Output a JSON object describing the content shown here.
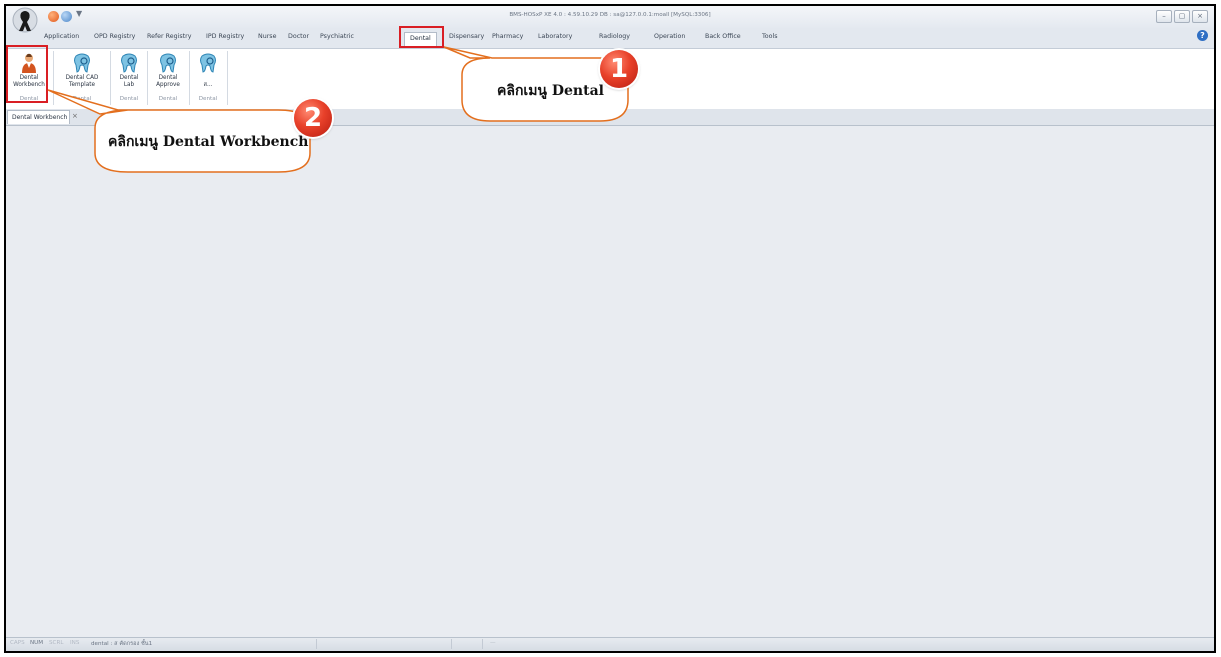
{
  "window": {
    "title": "BMS-HOSxP XE 4.0 : 4.59.10.29 DB : sa@127.0.0.1:moall [MySQL:3306]",
    "controls": [
      "–",
      "▢",
      "×"
    ]
  },
  "menu": {
    "tabs": [
      "Application",
      "OPD Registry",
      "Refer Registry",
      "IPD Registry",
      "Nurse",
      "Doctor",
      "Psychiatric",
      "Dental",
      "Dispensary",
      "Pharmacy",
      "Laboratory",
      "Radiology",
      "Operation",
      "Back Office",
      "Tools"
    ],
    "active_tab": "Dental",
    "help_icon": "?"
  },
  "ribbon": {
    "items": [
      {
        "label_line1": "Dental",
        "label_line2": "Workbench",
        "group": "Dental",
        "icon": "dentist-person-icon"
      },
      {
        "label_line1": "Dental CAD",
        "label_line2": "Template",
        "group": "Dental",
        "icon": "tooth-icon"
      },
      {
        "label_line1": "Dental",
        "label_line2": "Lab",
        "group": "Dental",
        "icon": "tooth-icon"
      },
      {
        "label_line1": "Dental",
        "label_line2": "Approve",
        "group": "Dental",
        "icon": "tooth-icon"
      },
      {
        "label_line1": "",
        "label_line2": "ส...",
        "group": "Dental",
        "icon": "tooth-icon"
      }
    ]
  },
  "document_tab": {
    "label": "Dental Workbench",
    "close": "×"
  },
  "statusbar": {
    "caps": "CAPS",
    "num": "NUM",
    "scrl": "SCRL",
    "ins": "INS",
    "info": "dental : ส คัดกรอง ชั้น1"
  },
  "annotations": {
    "callout1": {
      "text": "คลิกเมนู Dental",
      "number": "1"
    },
    "callout2": {
      "text": "คลิกเมนู Dental Workbench",
      "number": "2"
    },
    "highlight_color": "#d91e24",
    "callout_border_color": "#e36f1e"
  }
}
